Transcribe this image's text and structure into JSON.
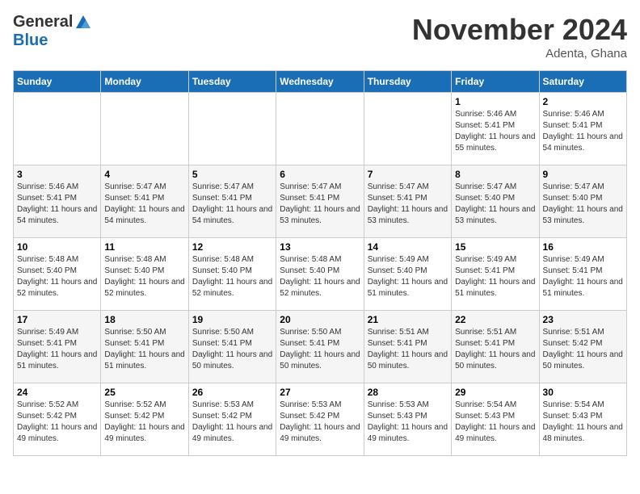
{
  "logo": {
    "general": "General",
    "blue": "Blue"
  },
  "title": {
    "month": "November 2024",
    "location": "Adenta, Ghana"
  },
  "headers": [
    "Sunday",
    "Monday",
    "Tuesday",
    "Wednesday",
    "Thursday",
    "Friday",
    "Saturday"
  ],
  "weeks": [
    [
      {
        "day": "",
        "info": ""
      },
      {
        "day": "",
        "info": ""
      },
      {
        "day": "",
        "info": ""
      },
      {
        "day": "",
        "info": ""
      },
      {
        "day": "",
        "info": ""
      },
      {
        "day": "1",
        "info": "Sunrise: 5:46 AM\nSunset: 5:41 PM\nDaylight: 11 hours and 55 minutes."
      },
      {
        "day": "2",
        "info": "Sunrise: 5:46 AM\nSunset: 5:41 PM\nDaylight: 11 hours and 54 minutes."
      }
    ],
    [
      {
        "day": "3",
        "info": "Sunrise: 5:46 AM\nSunset: 5:41 PM\nDaylight: 11 hours and 54 minutes."
      },
      {
        "day": "4",
        "info": "Sunrise: 5:47 AM\nSunset: 5:41 PM\nDaylight: 11 hours and 54 minutes."
      },
      {
        "day": "5",
        "info": "Sunrise: 5:47 AM\nSunset: 5:41 PM\nDaylight: 11 hours and 54 minutes."
      },
      {
        "day": "6",
        "info": "Sunrise: 5:47 AM\nSunset: 5:41 PM\nDaylight: 11 hours and 53 minutes."
      },
      {
        "day": "7",
        "info": "Sunrise: 5:47 AM\nSunset: 5:41 PM\nDaylight: 11 hours and 53 minutes."
      },
      {
        "day": "8",
        "info": "Sunrise: 5:47 AM\nSunset: 5:40 PM\nDaylight: 11 hours and 53 minutes."
      },
      {
        "day": "9",
        "info": "Sunrise: 5:47 AM\nSunset: 5:40 PM\nDaylight: 11 hours and 53 minutes."
      }
    ],
    [
      {
        "day": "10",
        "info": "Sunrise: 5:48 AM\nSunset: 5:40 PM\nDaylight: 11 hours and 52 minutes."
      },
      {
        "day": "11",
        "info": "Sunrise: 5:48 AM\nSunset: 5:40 PM\nDaylight: 11 hours and 52 minutes."
      },
      {
        "day": "12",
        "info": "Sunrise: 5:48 AM\nSunset: 5:40 PM\nDaylight: 11 hours and 52 minutes."
      },
      {
        "day": "13",
        "info": "Sunrise: 5:48 AM\nSunset: 5:40 PM\nDaylight: 11 hours and 52 minutes."
      },
      {
        "day": "14",
        "info": "Sunrise: 5:49 AM\nSunset: 5:40 PM\nDaylight: 11 hours and 51 minutes."
      },
      {
        "day": "15",
        "info": "Sunrise: 5:49 AM\nSunset: 5:41 PM\nDaylight: 11 hours and 51 minutes."
      },
      {
        "day": "16",
        "info": "Sunrise: 5:49 AM\nSunset: 5:41 PM\nDaylight: 11 hours and 51 minutes."
      }
    ],
    [
      {
        "day": "17",
        "info": "Sunrise: 5:49 AM\nSunset: 5:41 PM\nDaylight: 11 hours and 51 minutes."
      },
      {
        "day": "18",
        "info": "Sunrise: 5:50 AM\nSunset: 5:41 PM\nDaylight: 11 hours and 51 minutes."
      },
      {
        "day": "19",
        "info": "Sunrise: 5:50 AM\nSunset: 5:41 PM\nDaylight: 11 hours and 50 minutes."
      },
      {
        "day": "20",
        "info": "Sunrise: 5:50 AM\nSunset: 5:41 PM\nDaylight: 11 hours and 50 minutes."
      },
      {
        "day": "21",
        "info": "Sunrise: 5:51 AM\nSunset: 5:41 PM\nDaylight: 11 hours and 50 minutes."
      },
      {
        "day": "22",
        "info": "Sunrise: 5:51 AM\nSunset: 5:41 PM\nDaylight: 11 hours and 50 minutes."
      },
      {
        "day": "23",
        "info": "Sunrise: 5:51 AM\nSunset: 5:42 PM\nDaylight: 11 hours and 50 minutes."
      }
    ],
    [
      {
        "day": "24",
        "info": "Sunrise: 5:52 AM\nSunset: 5:42 PM\nDaylight: 11 hours and 49 minutes."
      },
      {
        "day": "25",
        "info": "Sunrise: 5:52 AM\nSunset: 5:42 PM\nDaylight: 11 hours and 49 minutes."
      },
      {
        "day": "26",
        "info": "Sunrise: 5:53 AM\nSunset: 5:42 PM\nDaylight: 11 hours and 49 minutes."
      },
      {
        "day": "27",
        "info": "Sunrise: 5:53 AM\nSunset: 5:42 PM\nDaylight: 11 hours and 49 minutes."
      },
      {
        "day": "28",
        "info": "Sunrise: 5:53 AM\nSunset: 5:43 PM\nDaylight: 11 hours and 49 minutes."
      },
      {
        "day": "29",
        "info": "Sunrise: 5:54 AM\nSunset: 5:43 PM\nDaylight: 11 hours and 49 minutes."
      },
      {
        "day": "30",
        "info": "Sunrise: 5:54 AM\nSunset: 5:43 PM\nDaylight: 11 hours and 48 minutes."
      }
    ]
  ]
}
